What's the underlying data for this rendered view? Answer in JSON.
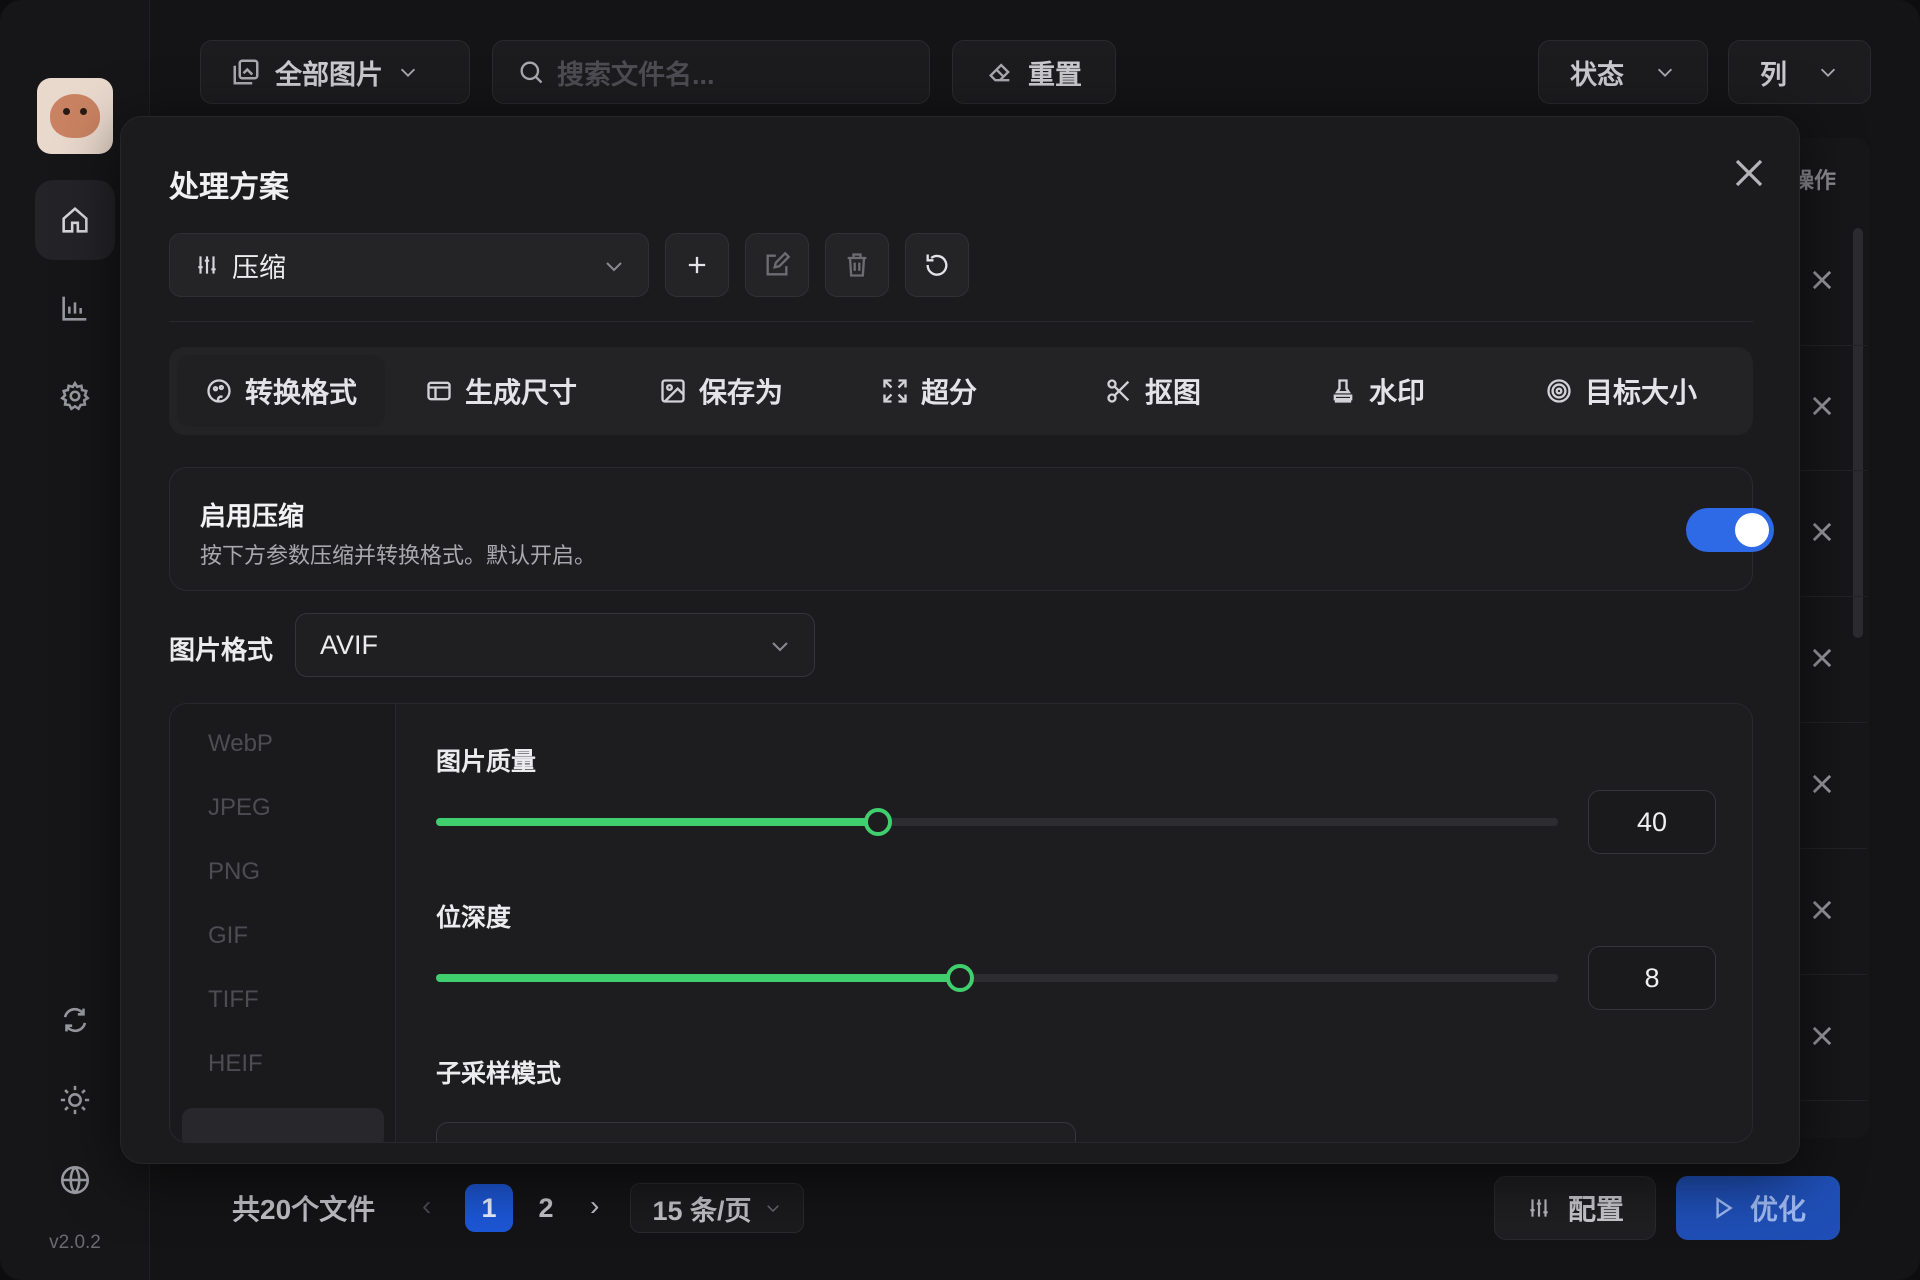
{
  "app": {
    "version": "v2.0.2"
  },
  "toolbar": {
    "all_images": "全部图片",
    "search_placeholder": "搜索文件名...",
    "reset": "重置",
    "status": "状态",
    "columns": "列"
  },
  "table": {
    "actions_header_partial": "操作"
  },
  "footer": {
    "total": "共20个文件",
    "pages": [
      "1",
      "2"
    ],
    "current_page": "1",
    "page_size": "15 条/页",
    "config_button": "配置",
    "optimize_button": "优化"
  },
  "modal": {
    "title": "处理方案",
    "plan_selected": "压缩",
    "tabs": [
      {
        "label": "转换格式",
        "icon": "palette-icon",
        "active": true
      },
      {
        "label": "生成尺寸",
        "icon": "window-icon",
        "active": false
      },
      {
        "label": "保存为",
        "icon": "image-save-icon",
        "active": false
      },
      {
        "label": "超分",
        "icon": "expand-icon",
        "active": false
      },
      {
        "label": "抠图",
        "icon": "scissors-icon",
        "active": false
      },
      {
        "label": "水印",
        "icon": "stamp-icon",
        "active": false
      },
      {
        "label": "目标大小",
        "icon": "target-icon",
        "active": false
      }
    ],
    "enable": {
      "title": "启用压缩",
      "description": "按下方参数压缩并转换格式。默认开启。",
      "on": true
    },
    "format_label": "图片格式",
    "format_selected": "AVIF",
    "format_list": [
      "WebP",
      "JPEG",
      "PNG",
      "GIF",
      "TIFF",
      "HEIF"
    ],
    "quality": {
      "label": "图片质量",
      "value": "40",
      "fraction": 0.394
    },
    "bit_depth": {
      "label": "位深度",
      "value": "8",
      "fraction": 0.467
    },
    "subsampling": {
      "label": "子采样模式"
    }
  },
  "colors": {
    "accent_blue": "#2f6ae6",
    "slider_green": "#3fcf6e",
    "primary_button": "#1f4fb6"
  }
}
